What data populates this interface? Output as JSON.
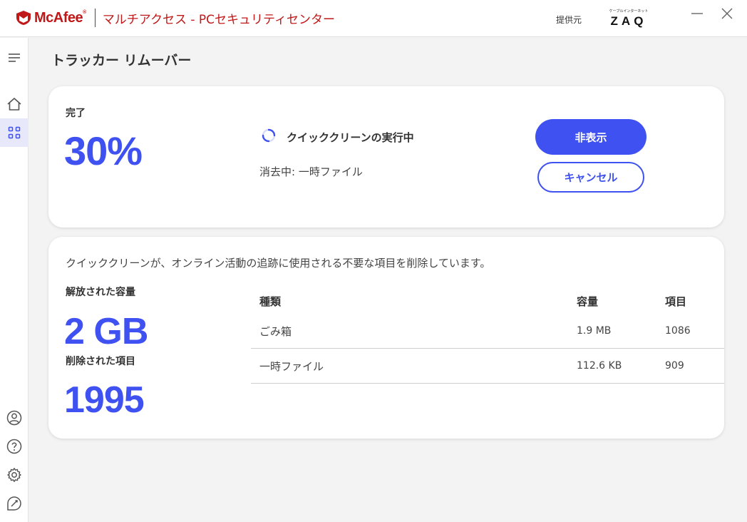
{
  "app": {
    "brand_name": "McAfee",
    "brand_mark": "®",
    "product_name": "マルチアクセス - PCセキュリティセンター",
    "provider_label": "提供元",
    "provider_logo_small": "ケーブルインターネット",
    "provider_logo_main": "ZAQ"
  },
  "page": {
    "title": "トラッカー リムーバー"
  },
  "progress_card": {
    "done_label": "完了",
    "percent_text": "30%",
    "percent_value": 30,
    "status_text": "クイッククリーンの実行中",
    "sub_status": "消去中: 一時ファイル",
    "hide_button": "非表示",
    "cancel_button": "キャンセル"
  },
  "summary_card": {
    "description": "クイッククリーンが、オンライン活動の追跡に使用される不要な項目を削除しています。",
    "freed_label": "解放された容量",
    "freed_value": "2 GB",
    "removed_label": "削除された項目",
    "removed_value": "1995",
    "table": {
      "headers": {
        "type": "種類",
        "size": "容量",
        "items": "項目"
      },
      "rows": [
        {
          "type": "ごみ箱",
          "size": "1.9 MB",
          "items": "1086"
        },
        {
          "type": "一時ファイル",
          "size": "112.6 KB",
          "items": "909"
        }
      ]
    }
  },
  "colors": {
    "accent": "#3f51f0",
    "brand_red": "#c01818"
  },
  "icons": {
    "sidebar_top": "menu-icon",
    "sidebar_nav": [
      "home-icon",
      "apps-grid-icon"
    ],
    "sidebar_bottom": [
      "account-icon",
      "help-icon",
      "settings-icon",
      "feedback-icon"
    ]
  }
}
